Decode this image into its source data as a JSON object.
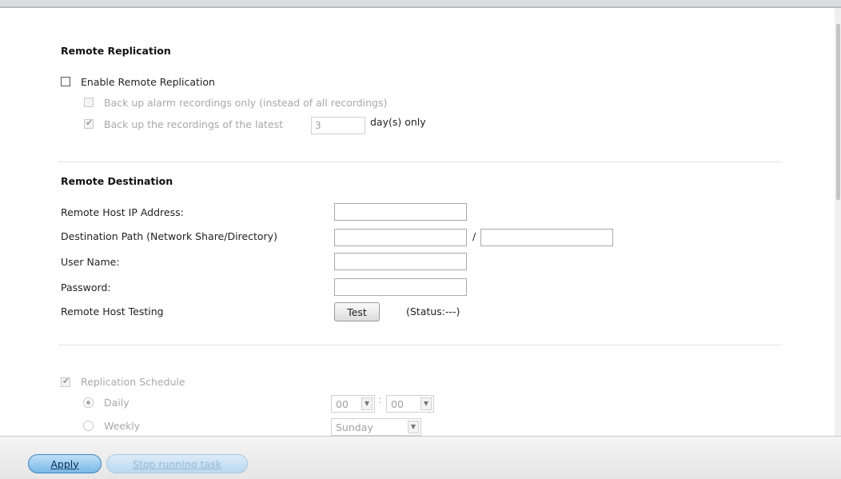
{
  "remote_replication": {
    "title": "Remote Replication",
    "enable_label": "Enable Remote Replication",
    "enable_checked": false,
    "alarm_only_label": "Back up alarm recordings only (instead of all recordings)",
    "alarm_only_checked": false,
    "latest_prefix": "Back up the recordings of the latest",
    "latest_checked": true,
    "latest_days_value": "3",
    "latest_suffix": "day(s) only"
  },
  "remote_destination": {
    "title": "Remote Destination",
    "host_ip_label": "Remote Host IP Address:",
    "host_ip_value": "",
    "dest_path_label": "Destination Path (Network Share/Directory)",
    "dest_share_value": "",
    "path_separator": "/",
    "dest_dir_value": "",
    "username_label": "User Name:",
    "username_value": "",
    "password_label": "Password:",
    "password_value": "",
    "testing_label": "Remote Host Testing",
    "test_button": "Test",
    "status_text": "(Status:---)"
  },
  "schedule": {
    "title": "Replication Schedule",
    "title_checked": true,
    "daily_label": "Daily",
    "daily_selected": true,
    "hour_value": "00",
    "time_separator": ":",
    "minute_value": "00",
    "weekly_label": "Weekly",
    "weekly_selected": false,
    "weekday_value": "Sunday"
  },
  "footer": {
    "apply_button": "Apply",
    "stop_button": "Stop running task"
  }
}
